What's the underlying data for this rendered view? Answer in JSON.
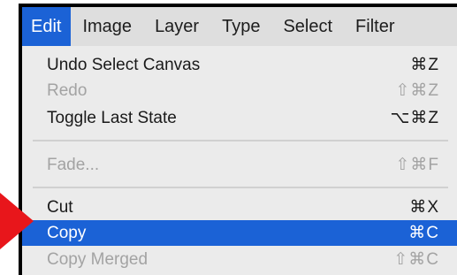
{
  "menubar": {
    "items": [
      "Edit",
      "Image",
      "Layer",
      "Type",
      "Select",
      "Filter"
    ],
    "active": "Edit"
  },
  "menu": {
    "items": [
      {
        "label": "Undo Select Canvas",
        "shortcut": "⌘Z",
        "enabled": true
      },
      {
        "label": "Redo",
        "shortcut": "⇧⌘Z",
        "enabled": false
      },
      {
        "label": "Toggle Last State",
        "shortcut": "⌥⌘Z",
        "enabled": true
      },
      {
        "label": "Fade...",
        "shortcut": "⇧⌘F",
        "enabled": false
      },
      {
        "label": "Cut",
        "shortcut": "⌘X",
        "enabled": true
      },
      {
        "label": "Copy",
        "shortcut": "⌘C",
        "enabled": true,
        "highlighted": true
      },
      {
        "label": "Copy Merged",
        "shortcut": "⇧⌘C",
        "enabled": false
      }
    ]
  },
  "colors": {
    "highlight": "#1b62d6",
    "arrow": "#e8161b",
    "disabled_text": "#a3a3a3",
    "menu_background": "#ebebeb"
  }
}
